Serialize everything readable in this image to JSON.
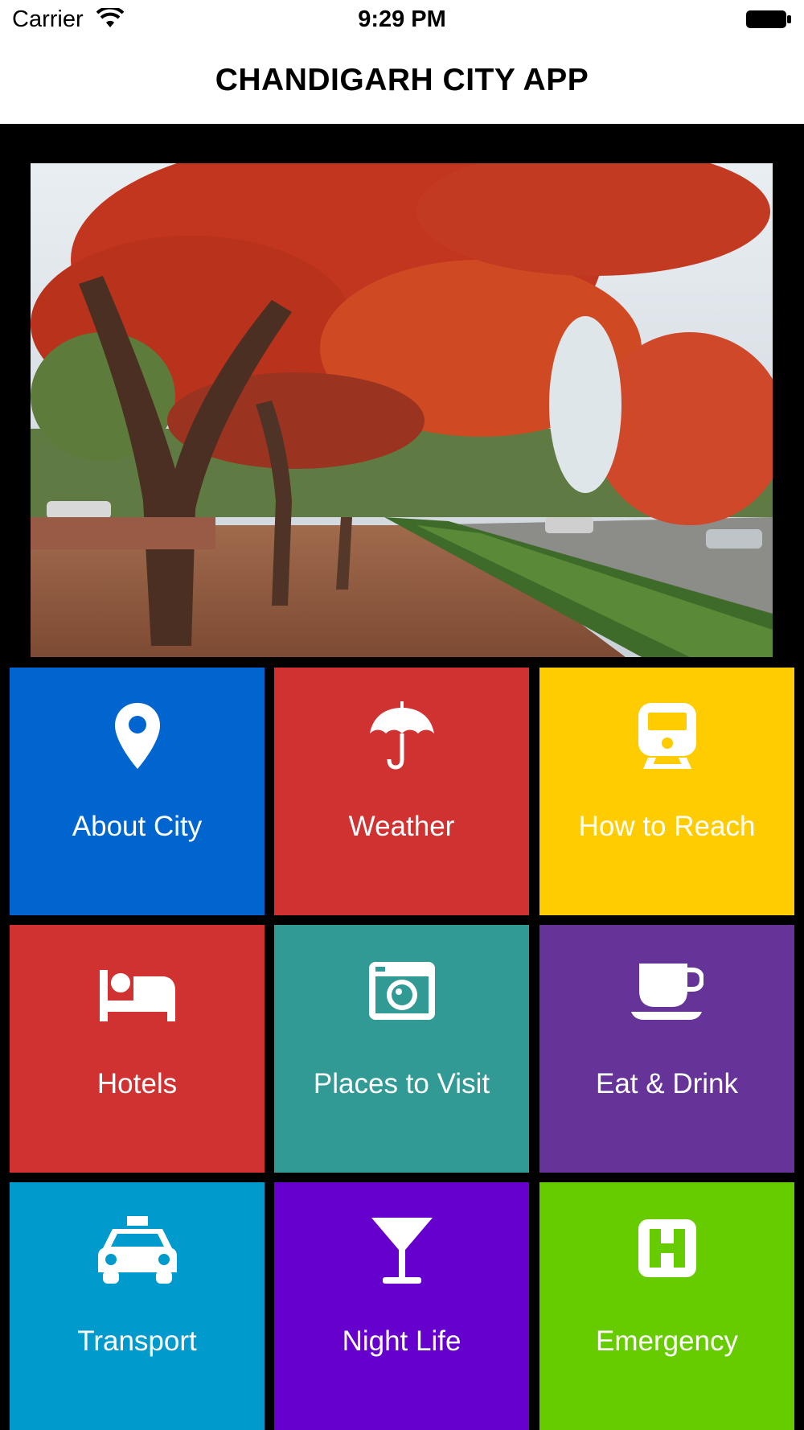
{
  "status_bar": {
    "carrier": "Carrier",
    "time": "9:29 PM",
    "icons": [
      "wifi-icon",
      "battery-icon"
    ]
  },
  "header": {
    "title": "CHANDIGARH CITY APP"
  },
  "hero": {
    "image": "red-flowering-trees-avenue"
  },
  "tiles": [
    {
      "label": "About City",
      "icon": "map-pin-icon",
      "color": "#0165d0"
    },
    {
      "label": "Weather",
      "icon": "umbrella-icon",
      "color": "#d03232"
    },
    {
      "label": "How to Reach",
      "icon": "train-icon",
      "color": "#fecc00"
    },
    {
      "label": "Hotels",
      "icon": "bed-icon",
      "color": "#d03232"
    },
    {
      "label": "Places to Visit",
      "icon": "camera-icon",
      "color": "#329a95"
    },
    {
      "label": "Eat & Drink",
      "icon": "coffee-cup-icon",
      "color": "#663399"
    },
    {
      "label": "Transport",
      "icon": "taxi-icon",
      "color": "#019acd"
    },
    {
      "label": "Night Life",
      "icon": "cocktail-icon",
      "color": "#6600cc"
    },
    {
      "label": "Emergency",
      "icon": "hospital-icon",
      "color": "#66cc00"
    }
  ]
}
